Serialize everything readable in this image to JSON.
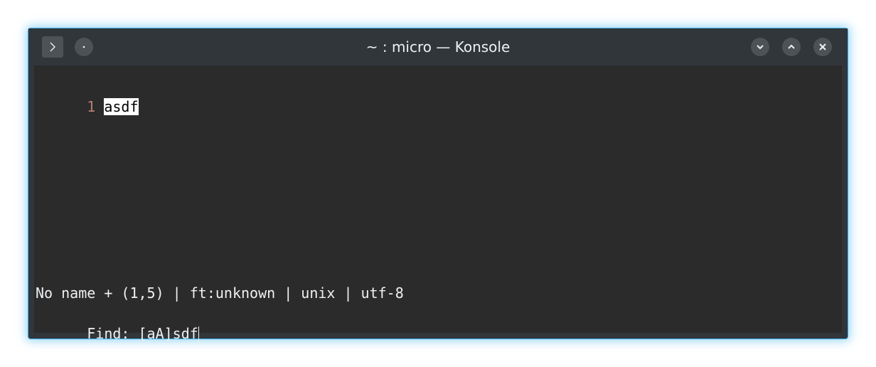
{
  "window": {
    "title": "~ : micro — Konsole"
  },
  "titlebar": {
    "menu_icon": "terminal-prompt-icon",
    "pin_icon": "dot-icon",
    "minimize_icon": "chevron-down-icon",
    "maximize_icon": "chevron-up-icon",
    "close_icon": "close-icon"
  },
  "editor": {
    "lines": [
      {
        "number": "1",
        "text": "asdf"
      }
    ],
    "status_bar": "No name + (1,5) | ft:unknown | unix | utf-8",
    "find_prompt": "Find: ",
    "find_query": "[aA]sdf"
  },
  "colors": {
    "accent": "#3daee9",
    "titlebar_bg": "#31363b",
    "terminal_bg": "#2b2b2b",
    "line_number": "#b88073",
    "selection_bg": "#ffffff"
  }
}
